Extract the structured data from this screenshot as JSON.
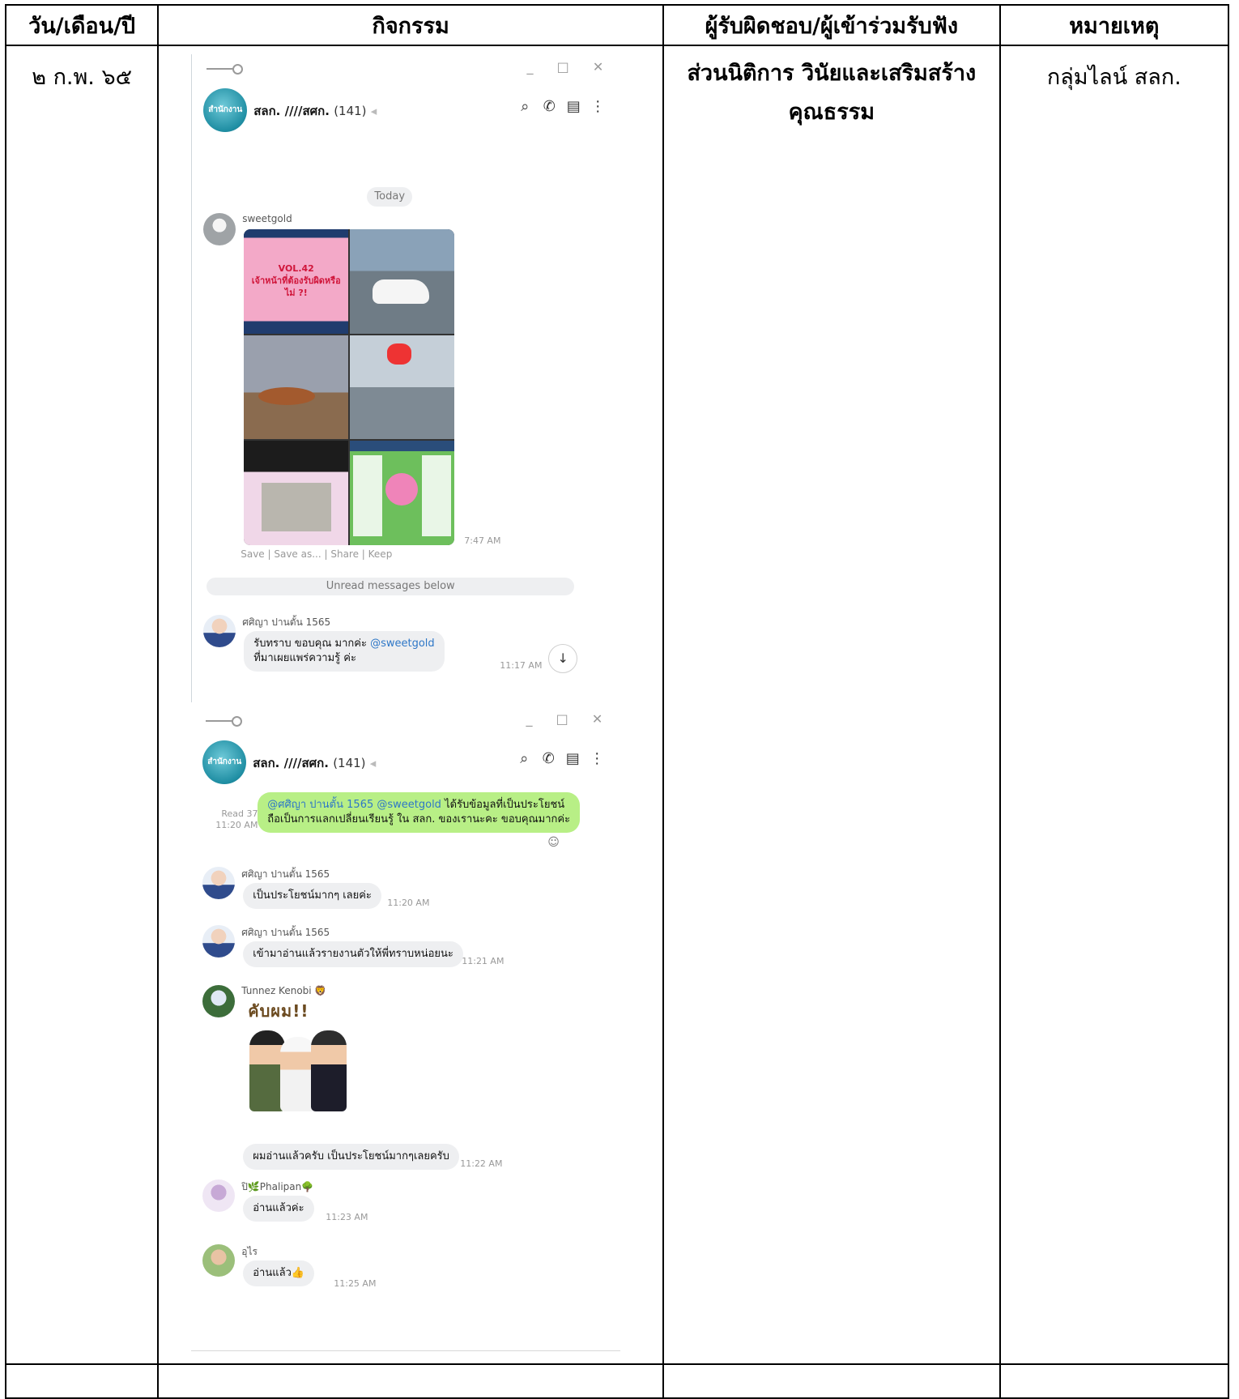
{
  "table": {
    "headers": [
      "วัน/เดือน/ปี",
      "กิจกรรม",
      "ผู้รับผิดชอบ/ผู้เข้าร่วมรับฟัง",
      "หมายเหตุ"
    ],
    "date": "๒ ก.พ. ๖๕",
    "responsible_line1": "ส่วนนิติการ วินัยและเสริมสร้าง",
    "responsible_line2": "คุณธรรม",
    "note": "กลุ่มไลน์ สลก."
  },
  "chat": {
    "group_avatar_text": "สำนักงาน",
    "group_name": "สลก. ////สศก.",
    "member_count": "(141)",
    "window_buttons": "_ □ ✕",
    "today_label": "Today",
    "post": {
      "sender": "sweetgold",
      "time": "7:47 AM",
      "tile1_vol": "VOL.42",
      "tile1_title": "เจ้าหน้าที่ต้องรับผิดหรือไม่ ?!",
      "save_bar": "Save | Save as... | Share | Keep"
    },
    "unread_label": "Unread messages below",
    "reply1": {
      "sender": "ศศิญา ปานตั้น 1565",
      "line1_text": "รับทราบ ขอบคุณ มากค่ะ ",
      "line1_mention": "@sweetgold",
      "line2": "ที่มาเผยแพร่ความรู้ ค่ะ",
      "time": "11:17 AM"
    },
    "scroll_icon": "↓",
    "own_message": {
      "read_label": "Read 37",
      "read_time": "11:20 AM",
      "mention": "@ศศิญา ปานตั้น 1565 @sweetgold",
      "text_a": " ได้รับข้อมูลที่เป็นประโยชน์",
      "text_b": "ถือเป็นการแลกเปลี่ยนเรียนรู้ ใน สลก. ของเรานะคะ ขอบคุณมากค่ะ"
    },
    "messages": [
      {
        "sender": "ศศิญา ปานตั้น 1565",
        "text": "เป็นประโยชน์มากๆ เลยค่ะ",
        "time": "11:20 AM"
      },
      {
        "sender": "ศศิญา ปานตั้น 1565",
        "text": "เข้ามาอ่านแล้วรายงานตัวให้พี่ทราบหน่อยนะ",
        "time": "11:21 AM"
      },
      {
        "sender": "Tunnez Kenobi 🦁",
        "text": "ผมอ่านแล้วครับ เป็นประโยชน์มากๆเลยครับ",
        "time": "11:22 AM",
        "sticker_text": "คับผม!!"
      },
      {
        "sender": "ปิ🌿Phalipan🌳",
        "text": "อ่านแล้วค่ะ",
        "time": "11:23 AM"
      },
      {
        "sender": "อุไร",
        "text": "อ่านแล้ว👍",
        "time": "11:25 AM"
      }
    ]
  }
}
